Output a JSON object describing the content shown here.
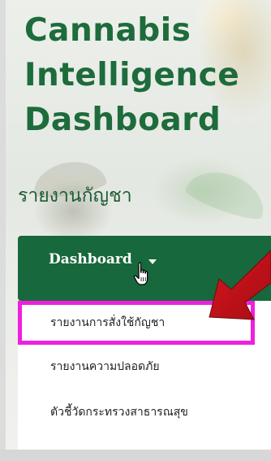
{
  "app": {
    "title_lines": [
      "Cannabis",
      "Intelligence",
      "Dashboard"
    ],
    "subtitle": "รายงานกัญชา"
  },
  "nav": {
    "dashboard_label": "Dashboard",
    "dropdown_icon": "caret-down-icon",
    "cursor_icon": "hand-pointer-icon"
  },
  "menu": {
    "items": [
      {
        "label": "รายงานการสั่งใช้กัญชา",
        "highlighted": true
      },
      {
        "label": "รายงานความปลอดภัย",
        "highlighted": false
      },
      {
        "label": "ตัวชี้วัดกระทรวงสาธารณสุข",
        "highlighted": false
      }
    ]
  },
  "annotation": {
    "arrow_icon": "red-arrow-icon",
    "highlight_color": "#ef1fe0",
    "arrow_color": "#c8101a"
  },
  "colors": {
    "brand_green": "#1e6b3c",
    "bar_green": "#17683c"
  }
}
